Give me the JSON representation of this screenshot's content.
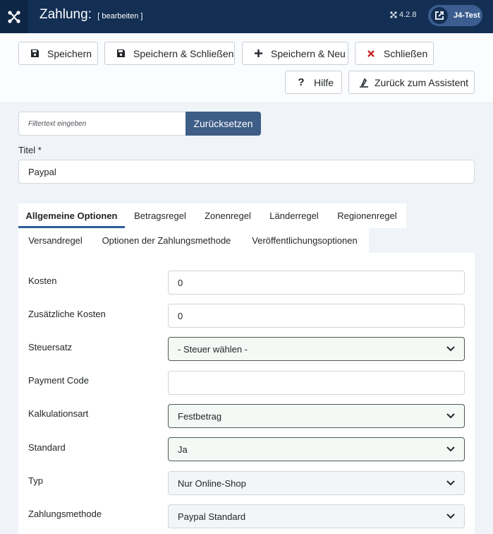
{
  "header": {
    "title": "Zahlung:",
    "subtitle": "[ bearbeiten ]",
    "version": "4.2.8",
    "site_name": "J4-Test"
  },
  "toolbar": {
    "save": "Speichern",
    "save_close": "Speichern & Schließen",
    "save_new": "Speichern & Neu",
    "close": "Schließen",
    "help": "Hilfe",
    "back_wizard": "Zurück zum Assistent"
  },
  "filter": {
    "placeholder": "Filtertext eingeben",
    "reset": "Zurücksetzen"
  },
  "title_field": {
    "label": "Titel *",
    "value": "Paypal"
  },
  "tabs": [
    {
      "label": "Allgemeine Optionen",
      "active": true
    },
    {
      "label": "Betragsregel"
    },
    {
      "label": "Zonenregel"
    },
    {
      "label": "Länderregel"
    },
    {
      "label": "Regionenregel"
    },
    {
      "label": "Versandregel"
    },
    {
      "label": "Optionen der Zahlungsmethode"
    },
    {
      "label": "Veröffentlichungsoptionen"
    }
  ],
  "fields": [
    {
      "label": "Kosten",
      "value": "0",
      "kind": "input"
    },
    {
      "label": "Zusätzliche Kosten",
      "value": "0",
      "kind": "input"
    },
    {
      "label": "Steuersatz",
      "value": "- Steuer wählen -",
      "kind": "select"
    },
    {
      "label": "Payment Code",
      "value": "",
      "kind": "input"
    },
    {
      "label": "Kalkulationsart",
      "value": "Festbetrag",
      "kind": "select"
    },
    {
      "label": "Standard",
      "value": "Ja",
      "kind": "select"
    },
    {
      "label": "Typ",
      "value": "Nur Online-Shop",
      "kind": "select"
    },
    {
      "label": "Zahlungsmethode",
      "value": "Paypal Standard",
      "kind": "select"
    }
  ],
  "colors": {
    "header_bg": "#132f53",
    "primary_button": "#3e5d87",
    "close_icon": "#c52827",
    "tab_underline": "#2f5d9a"
  }
}
